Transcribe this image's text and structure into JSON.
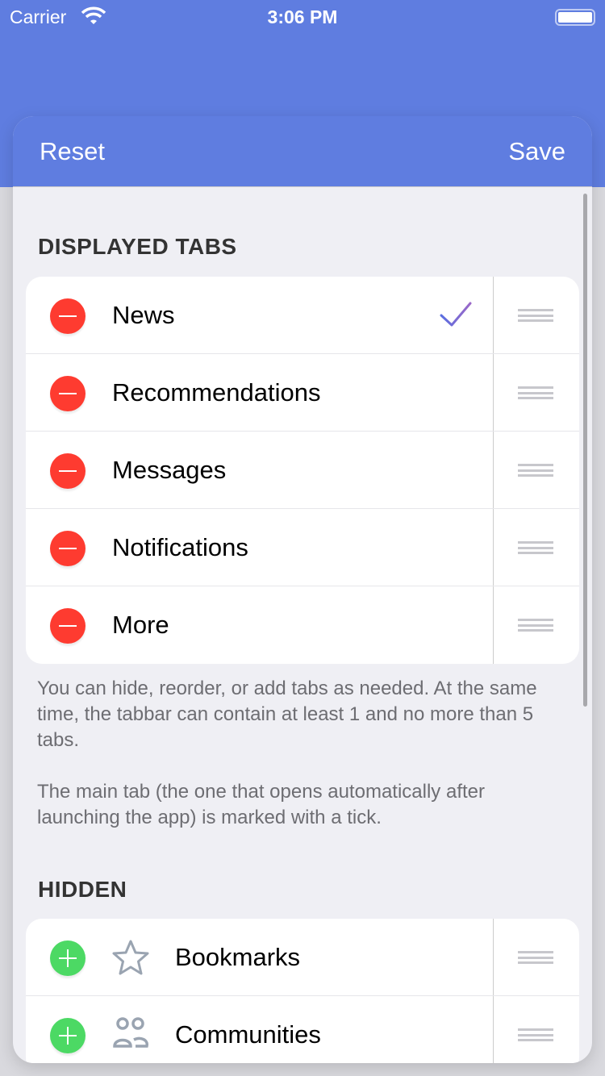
{
  "status_bar": {
    "carrier": "Carrier",
    "time": "3:06 PM"
  },
  "nav": {
    "reset": "Reset",
    "save": "Save"
  },
  "colors": {
    "accent": "#5f7de0",
    "remove": "#fe3b30",
    "add": "#4cd964"
  },
  "displayed": {
    "header": "DISPLAYED TABS",
    "items": [
      {
        "label": "News",
        "main": true
      },
      {
        "label": "Recommendations"
      },
      {
        "label": "Messages"
      },
      {
        "label": "Notifications"
      },
      {
        "label": "More"
      }
    ],
    "footer1": "You can hide, reorder, or add tabs as needed. At the same time, the tabbar can contain at least 1 and no more than 5 tabs.",
    "footer2": "The main tab (the one that opens automatically after launching the app) is marked with a tick."
  },
  "hidden": {
    "header": "HIDDEN",
    "items": [
      {
        "label": "Bookmarks",
        "icon": "star-icon"
      },
      {
        "label": "Communities",
        "icon": "people-icon"
      }
    ]
  }
}
